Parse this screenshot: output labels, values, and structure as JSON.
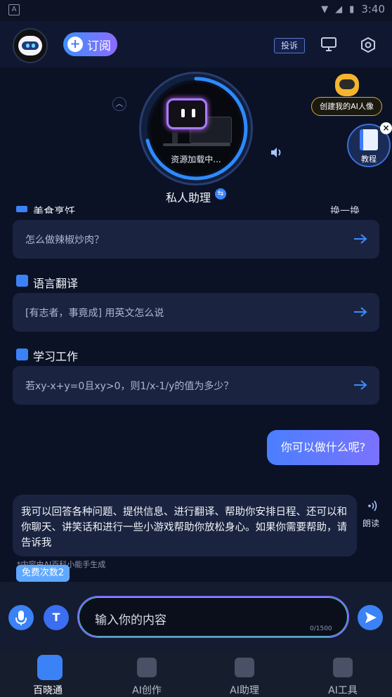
{
  "status_bar": {
    "time": "3:40",
    "left_icon": "A"
  },
  "header": {
    "subscribe_label": "订阅",
    "complain_label": "投诉"
  },
  "assistant": {
    "loading_text": "资源加载中...",
    "name": "私人助理"
  },
  "floating": {
    "create_avatar_label": "创建我的AI人像",
    "tutorial_label": "教程"
  },
  "sections": {
    "food_partial": "美食烹饪",
    "refresh_partial": "换一换",
    "food_prompt": "怎么做辣椒炒肉？",
    "translate_title": "语言翻译",
    "translate_prompt": "[有志者，事竟成] 用英文怎么说",
    "study_title": "学习工作",
    "study_prompt": "若xy-x+y=0且xy>0，则1/x-1/y的值为多少？"
  },
  "chat": {
    "user_message": "你可以做什么呢?",
    "ai_message": "我可以回答各种问题、提供信息、进行翻译、帮助你安排日程、还可以和你聊天、讲笑话和进行一些小游戏帮助你放松身心。如果你需要帮助，请告诉我",
    "read_label": "朗读",
    "ai_note": "*内容由AI百科小能手生成",
    "free_badge": "免费次数2"
  },
  "input": {
    "placeholder": "输入你的内容",
    "char_count": "0/1500"
  },
  "nav": [
    {
      "label": "百晓通"
    },
    {
      "label": "AI创作"
    },
    {
      "label": "AI助理"
    },
    {
      "label": "AI工具"
    }
  ],
  "colors": {
    "accent": "#3b82f6",
    "background": "#0b1226",
    "card": "#1a2440",
    "gold": "#d9a73a"
  }
}
